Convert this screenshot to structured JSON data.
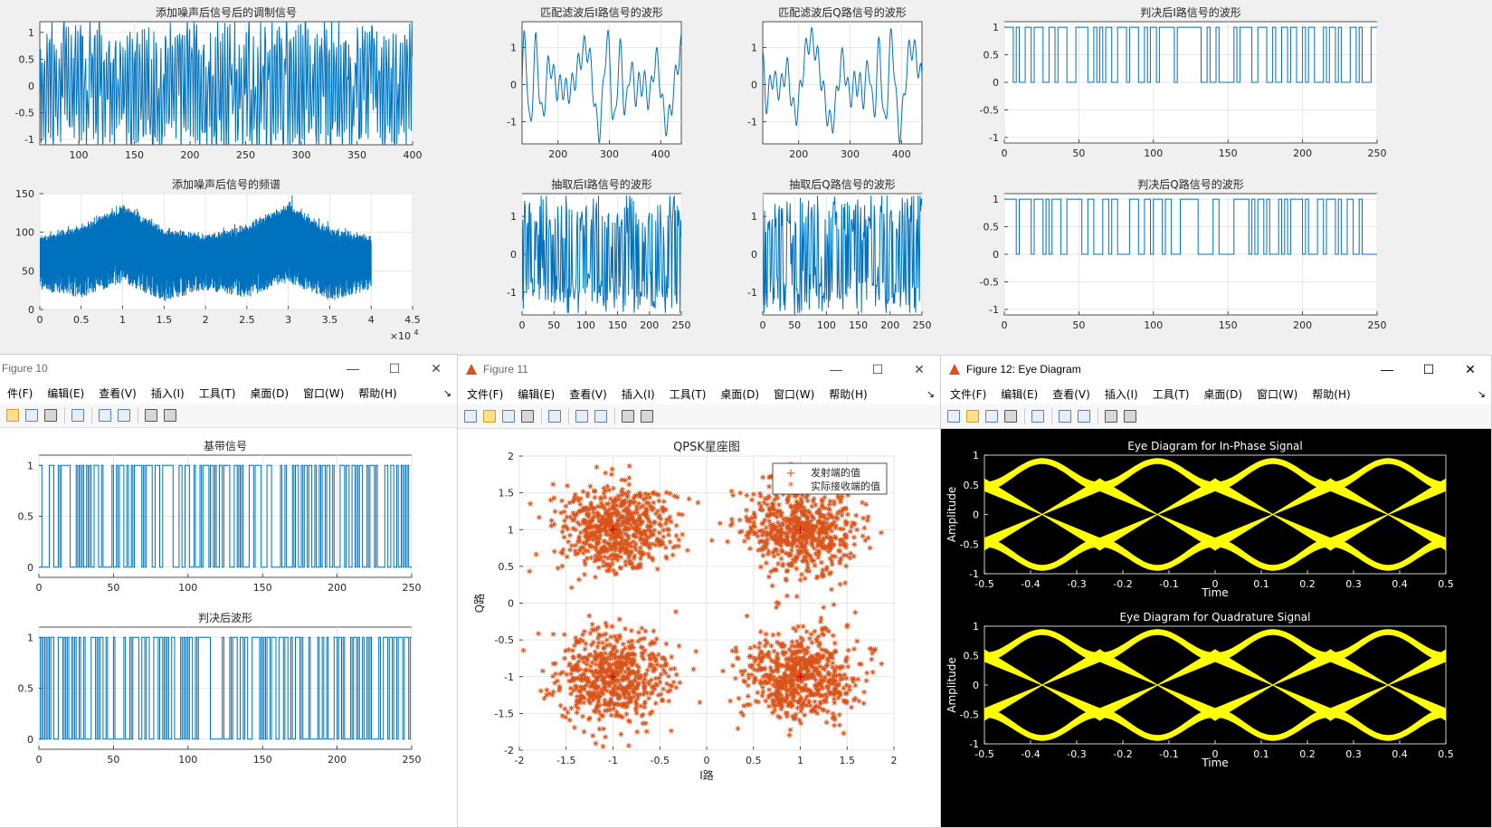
{
  "windows": {
    "fig10": {
      "title": "Figure 10",
      "menus": [
        "件(F)",
        "编辑(E)",
        "查看(V)",
        "插入(I)",
        "工具(T)",
        "桌面(D)",
        "窗口(W)",
        "帮助(H)"
      ]
    },
    "fig11": {
      "title": "Figure 11",
      "menus": [
        "文件(F)",
        "编辑(E)",
        "查看(V)",
        "插入(I)",
        "工具(T)",
        "桌面(D)",
        "窗口(W)",
        "帮助(H)"
      ]
    },
    "fig12": {
      "title": "Figure 12: Eye Diagram",
      "menus": [
        "文件(F)",
        "编辑(E)",
        "查看(V)",
        "插入(I)",
        "工具(T)",
        "桌面(D)",
        "窗口(W)",
        "帮助(H)"
      ]
    },
    "controls": {
      "min": "—",
      "max": "☐",
      "close": "✕",
      "arrow": "↘"
    }
  },
  "colors": {
    "line": "#0072bd",
    "scatter": "#d95319",
    "eye_bg": "#000000",
    "eye_fg": "#ffff00"
  },
  "chart_data": [
    {
      "id": "noisy",
      "type": "line",
      "title": "添加噪声后信号后的调制信号",
      "xlim": [
        65,
        400
      ],
      "ylim": [
        -1.1,
        1.2
      ],
      "xticks": [
        "100",
        "150",
        "200",
        "250",
        "300",
        "350",
        "400"
      ],
      "yticks": [
        "1",
        "0.5",
        "0",
        "-0.5",
        "-1"
      ],
      "series": [
        {
          "style": "dense-noise-wave"
        }
      ]
    },
    {
      "id": "spectrum",
      "type": "area",
      "title": "添加噪声后信号的频谱",
      "xlim": [
        0,
        45000
      ],
      "ylim": [
        0,
        150
      ],
      "xticks": [
        "0",
        "0.5",
        "1",
        "1.5",
        "2",
        "2.5",
        "3",
        "3.5",
        "4",
        "4.5"
      ],
      "yticks": [
        "150",
        "100",
        "50",
        "0"
      ],
      "x_exponent": "×10",
      "x_exponent_power": "4",
      "envelope": {
        "x": [
          0,
          5000,
          10000,
          15000,
          20000,
          25000,
          30000,
          35000,
          40000
        ],
        "upper": [
          90,
          102,
          130,
          98,
          90,
          102,
          130,
          98,
          90
        ],
        "lower": [
          55,
          45,
          65,
          40,
          55,
          45,
          65,
          40,
          55
        ]
      }
    },
    {
      "id": "mf_i",
      "type": "line",
      "title": "匹配滤波后I路信号的波形",
      "xlim": [
        130,
        440
      ],
      "ylim": [
        -1.6,
        1.7
      ],
      "xticks": [
        "200",
        "300",
        "400"
      ],
      "yticks": [
        "1",
        "0",
        "-1"
      ],
      "series": [
        {
          "style": "smooth-wave"
        }
      ]
    },
    {
      "id": "mf_q",
      "type": "line",
      "title": "匹配滤波后Q路信号的波形",
      "xlim": [
        130,
        440
      ],
      "ylim": [
        -1.6,
        1.7
      ],
      "xticks": [
        "200",
        "300",
        "400"
      ],
      "yticks": [
        "1",
        "0",
        "-1"
      ],
      "series": [
        {
          "style": "smooth-wave"
        }
      ]
    },
    {
      "id": "ds_i",
      "type": "line",
      "title": "抽取后I路信号的波形",
      "xlim": [
        0,
        250
      ],
      "ylim": [
        -1.6,
        1.6
      ],
      "xticks": [
        "0",
        "50",
        "100",
        "150",
        "200",
        "250"
      ],
      "yticks": [
        "1",
        "0",
        "-1"
      ],
      "series": [
        {
          "style": "sampled-wave"
        }
      ]
    },
    {
      "id": "ds_q",
      "type": "line",
      "title": "抽取后Q路信号的波形",
      "xlim": [
        0,
        250
      ],
      "ylim": [
        -1.6,
        1.6
      ],
      "xticks": [
        "0",
        "50",
        "100",
        "150",
        "200",
        "250"
      ],
      "yticks": [
        "1",
        "0",
        "-1"
      ],
      "series": [
        {
          "style": "sampled-wave"
        }
      ]
    },
    {
      "id": "dec_i",
      "type": "line",
      "title": "判决后I路信号的波形",
      "xlim": [
        0,
        250
      ],
      "ylim": [
        -1.1,
        1.1
      ],
      "xticks": [
        "0",
        "50",
        "100",
        "150",
        "200",
        "250"
      ],
      "yticks": [
        "1",
        "0.5",
        "0",
        "-0.5",
        "-1"
      ],
      "series": [
        {
          "style": "binary-step",
          "levels": [
            0,
            1
          ]
        }
      ]
    },
    {
      "id": "dec_q",
      "type": "line",
      "title": "判决后Q路信号的波形",
      "xlim": [
        0,
        250
      ],
      "ylim": [
        -1.1,
        1.1
      ],
      "xticks": [
        "0",
        "50",
        "100",
        "150",
        "200",
        "250"
      ],
      "yticks": [
        "1",
        "0.5",
        "0",
        "-0.5",
        "-1"
      ],
      "series": [
        {
          "style": "binary-step",
          "levels": [
            0,
            1
          ]
        }
      ]
    },
    {
      "id": "baseband",
      "type": "line",
      "title": "基带信号",
      "xlim": [
        0,
        250
      ],
      "ylim": [
        -0.1,
        1.1
      ],
      "xticks": [
        "0",
        "50",
        "100",
        "150",
        "200",
        "250"
      ],
      "yticks": [
        "1",
        "0.5",
        "0"
      ],
      "series": [
        {
          "style": "binary-step",
          "levels": [
            0,
            1
          ]
        }
      ]
    },
    {
      "id": "decided",
      "type": "line",
      "title": "判决后波形",
      "xlim": [
        0,
        250
      ],
      "ylim": [
        -0.1,
        1.1
      ],
      "xticks": [
        "0",
        "50",
        "100",
        "150",
        "200",
        "250"
      ],
      "yticks": [
        "1",
        "0.5",
        "0"
      ],
      "series": [
        {
          "style": "binary-step",
          "levels": [
            0,
            1
          ]
        }
      ]
    },
    {
      "id": "qpsk",
      "type": "scatter",
      "title": "QPSK星座图",
      "xlabel": "I路",
      "ylabel": "Q路",
      "xlim": [
        -2,
        2
      ],
      "ylim": [
        -2,
        2
      ],
      "xticks": [
        "-2",
        "-1.5",
        "-1",
        "-0.5",
        "0",
        "0.5",
        "1",
        "1.5",
        "2"
      ],
      "yticks": [
        "2",
        "1.5",
        "1",
        "0.5",
        "0",
        "-0.5",
        "-1",
        "-1.5",
        "-2"
      ],
      "legend": {
        "placement": "top-right",
        "entries": [
          {
            "marker": "+",
            "label": "发射端的值"
          },
          {
            "marker": "*",
            "label": "实际接收端的值"
          }
        ]
      },
      "clusters": [
        {
          "x": -1,
          "y": 1
        },
        {
          "x": 1,
          "y": 1
        },
        {
          "x": -1,
          "y": -1
        },
        {
          "x": 1,
          "y": -1
        }
      ],
      "spread": 0.3
    },
    {
      "id": "eye_i",
      "type": "line",
      "title": "Eye Diagram for In-Phase Signal",
      "xlabel": "Time",
      "ylabel": "Amplitude",
      "xlim": [
        -0.5,
        0.5
      ],
      "ylim": [
        -1,
        1
      ],
      "xticks": [
        "-0.5",
        "-0.4",
        "-0.3",
        "-0.2",
        "-0.1",
        "0",
        "0.1",
        "0.2",
        "0.3",
        "0.4",
        "0.5"
      ],
      "yticks": [
        "1",
        "0.5",
        "0",
        "-0.5",
        "-1"
      ]
    },
    {
      "id": "eye_q",
      "type": "line",
      "title": "Eye Diagram for Quadrature Signal",
      "xlabel": "Time",
      "ylabel": "Amplitude",
      "xlim": [
        -0.5,
        0.5
      ],
      "ylim": [
        -1,
        1
      ],
      "xticks": [
        "-0.5",
        "-0.4",
        "-0.3",
        "-0.2",
        "-0.1",
        "0",
        "0.1",
        "0.2",
        "0.3",
        "0.4",
        "0.5"
      ],
      "yticks": [
        "1",
        "0.5",
        "0",
        "-0.5",
        "-1"
      ]
    }
  ]
}
